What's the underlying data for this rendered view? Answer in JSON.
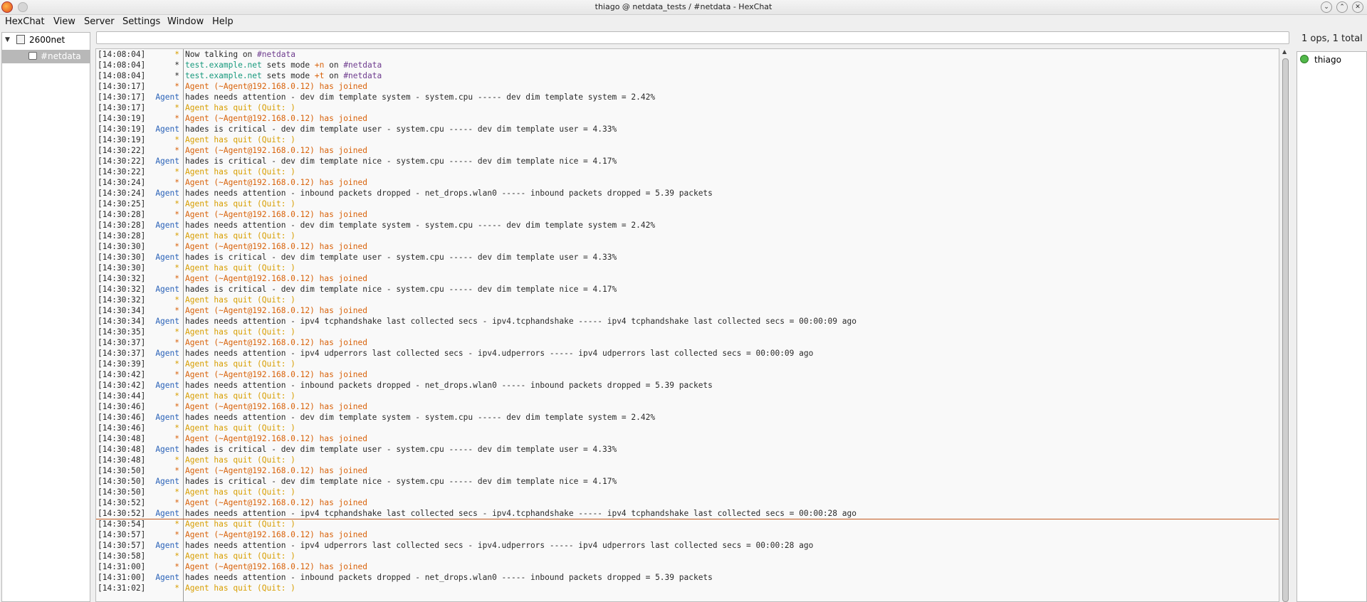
{
  "window": {
    "title": "thiago @ netdata_tests / #netdata - HexChat"
  },
  "menu": [
    {
      "label": "HexChat",
      "name": "menu-hexchat"
    },
    {
      "label": "View",
      "name": "menu-view"
    },
    {
      "label": "Server",
      "name": "menu-server"
    },
    {
      "label": "Settings",
      "name": "menu-settings"
    },
    {
      "label": "Window",
      "name": "menu-window"
    },
    {
      "label": "Help",
      "name": "menu-help"
    }
  ],
  "tree": {
    "server": "2600net",
    "channel": "#netdata"
  },
  "topic": {
    "value": ""
  },
  "ops_status": "1 ops, 1 total",
  "users": [
    {
      "name": "thiago",
      "status_color": "#52b84a"
    }
  ],
  "colors": {
    "join": "#d9620a",
    "quit": "#d89e00",
    "agent_nick": "#2a62b8",
    "server_host": "#199a7e",
    "channel_name": "#6f3d8f"
  },
  "chat_lines": [
    {
      "ts": "[14:08:04]",
      "nick": "*",
      "nick_class": "c-yellow",
      "parts": [
        {
          "t": "Now talking on ",
          "c": "c-dark"
        },
        {
          "t": "#netdata",
          "c": "c-purple"
        }
      ]
    },
    {
      "ts": "[14:08:04]",
      "nick": "*",
      "nick_class": "c-dark",
      "parts": [
        {
          "t": "test.example.net",
          "c": "c-teal"
        },
        {
          "t": " sets mode ",
          "c": "c-dark"
        },
        {
          "t": "+n",
          "c": "c-orange"
        },
        {
          "t": " on ",
          "c": "c-dark"
        },
        {
          "t": "#netdata",
          "c": "c-purple"
        }
      ]
    },
    {
      "ts": "[14:08:04]",
      "nick": "*",
      "nick_class": "c-dark",
      "parts": [
        {
          "t": "test.example.net",
          "c": "c-teal"
        },
        {
          "t": " sets mode ",
          "c": "c-dark"
        },
        {
          "t": "+t",
          "c": "c-orange"
        },
        {
          "t": " on ",
          "c": "c-dark"
        },
        {
          "t": "#netdata",
          "c": "c-purple"
        }
      ]
    },
    {
      "ts": "[14:30:17]",
      "nick": "*",
      "nick_class": "c-orange",
      "parts": [
        {
          "t": "Agent (~Agent@192.168.0.12) has joined",
          "c": "c-orange"
        }
      ]
    },
    {
      "ts": "[14:30:17]",
      "nick": "Agent",
      "nick_class": "c-blue",
      "parts": [
        {
          "t": "hades needs attention - dev dim template system - system.cpu ----- dev dim template system = 2.42%",
          "c": "c-dark"
        }
      ]
    },
    {
      "ts": "[14:30:17]",
      "nick": "*",
      "nick_class": "c-yellow",
      "parts": [
        {
          "t": "Agent has quit (Quit: )",
          "c": "c-yellow"
        }
      ]
    },
    {
      "ts": "[14:30:19]",
      "nick": "*",
      "nick_class": "c-orange",
      "parts": [
        {
          "t": "Agent (~Agent@192.168.0.12) has joined",
          "c": "c-orange"
        }
      ]
    },
    {
      "ts": "[14:30:19]",
      "nick": "Agent",
      "nick_class": "c-blue",
      "parts": [
        {
          "t": "hades is critical - dev dim template user - system.cpu ----- dev dim template user = 4.33%",
          "c": "c-dark"
        }
      ]
    },
    {
      "ts": "[14:30:19]",
      "nick": "*",
      "nick_class": "c-yellow",
      "parts": [
        {
          "t": "Agent has quit (Quit: )",
          "c": "c-yellow"
        }
      ]
    },
    {
      "ts": "[14:30:22]",
      "nick": "*",
      "nick_class": "c-orange",
      "parts": [
        {
          "t": "Agent (~Agent@192.168.0.12) has joined",
          "c": "c-orange"
        }
      ]
    },
    {
      "ts": "[14:30:22]",
      "nick": "Agent",
      "nick_class": "c-blue",
      "parts": [
        {
          "t": "hades is critical - dev dim template nice - system.cpu ----- dev dim template nice = 4.17%",
          "c": "c-dark"
        }
      ]
    },
    {
      "ts": "[14:30:22]",
      "nick": "*",
      "nick_class": "c-yellow",
      "parts": [
        {
          "t": "Agent has quit (Quit: )",
          "c": "c-yellow"
        }
      ]
    },
    {
      "ts": "[14:30:24]",
      "nick": "*",
      "nick_class": "c-orange",
      "parts": [
        {
          "t": "Agent (~Agent@192.168.0.12) has joined",
          "c": "c-orange"
        }
      ]
    },
    {
      "ts": "[14:30:24]",
      "nick": "Agent",
      "nick_class": "c-blue",
      "parts": [
        {
          "t": "hades needs attention - inbound packets dropped - net_drops.wlan0 ----- inbound packets dropped = 5.39 packets",
          "c": "c-dark"
        }
      ]
    },
    {
      "ts": "[14:30:25]",
      "nick": "*",
      "nick_class": "c-yellow",
      "parts": [
        {
          "t": "Agent has quit (Quit: )",
          "c": "c-yellow"
        }
      ]
    },
    {
      "ts": "[14:30:28]",
      "nick": "*",
      "nick_class": "c-orange",
      "parts": [
        {
          "t": "Agent (~Agent@192.168.0.12) has joined",
          "c": "c-orange"
        }
      ]
    },
    {
      "ts": "[14:30:28]",
      "nick": "Agent",
      "nick_class": "c-blue",
      "parts": [
        {
          "t": "hades needs attention - dev dim template system - system.cpu ----- dev dim template system = 2.42%",
          "c": "c-dark"
        }
      ]
    },
    {
      "ts": "[14:30:28]",
      "nick": "*",
      "nick_class": "c-yellow",
      "parts": [
        {
          "t": "Agent has quit (Quit: )",
          "c": "c-yellow"
        }
      ]
    },
    {
      "ts": "[14:30:30]",
      "nick": "*",
      "nick_class": "c-orange",
      "parts": [
        {
          "t": "Agent (~Agent@192.168.0.12) has joined",
          "c": "c-orange"
        }
      ]
    },
    {
      "ts": "[14:30:30]",
      "nick": "Agent",
      "nick_class": "c-blue",
      "parts": [
        {
          "t": "hades is critical - dev dim template user - system.cpu ----- dev dim template user = 4.33%",
          "c": "c-dark"
        }
      ]
    },
    {
      "ts": "[14:30:30]",
      "nick": "*",
      "nick_class": "c-yellow",
      "parts": [
        {
          "t": "Agent has quit (Quit: )",
          "c": "c-yellow"
        }
      ]
    },
    {
      "ts": "[14:30:32]",
      "nick": "*",
      "nick_class": "c-orange",
      "parts": [
        {
          "t": "Agent (~Agent@192.168.0.12) has joined",
          "c": "c-orange"
        }
      ]
    },
    {
      "ts": "[14:30:32]",
      "nick": "Agent",
      "nick_class": "c-blue",
      "parts": [
        {
          "t": "hades is critical - dev dim template nice - system.cpu ----- dev dim template nice = 4.17%",
          "c": "c-dark"
        }
      ]
    },
    {
      "ts": "[14:30:32]",
      "nick": "*",
      "nick_class": "c-yellow",
      "parts": [
        {
          "t": "Agent has quit (Quit: )",
          "c": "c-yellow"
        }
      ]
    },
    {
      "ts": "[14:30:34]",
      "nick": "*",
      "nick_class": "c-orange",
      "parts": [
        {
          "t": "Agent (~Agent@192.168.0.12) has joined",
          "c": "c-orange"
        }
      ]
    },
    {
      "ts": "[14:30:34]",
      "nick": "Agent",
      "nick_class": "c-blue",
      "parts": [
        {
          "t": "hades needs attention - ipv4 tcphandshake last collected secs - ipv4.tcphandshake ----- ipv4 tcphandshake last collected secs = 00:00:09 ago",
          "c": "c-dark"
        }
      ]
    },
    {
      "ts": "[14:30:35]",
      "nick": "*",
      "nick_class": "c-yellow",
      "parts": [
        {
          "t": "Agent has quit (Quit: )",
          "c": "c-yellow"
        }
      ]
    },
    {
      "ts": "[14:30:37]",
      "nick": "*",
      "nick_class": "c-orange",
      "parts": [
        {
          "t": "Agent (~Agent@192.168.0.12) has joined",
          "c": "c-orange"
        }
      ]
    },
    {
      "ts": "[14:30:37]",
      "nick": "Agent",
      "nick_class": "c-blue",
      "parts": [
        {
          "t": "hades needs attention - ipv4 udperrors last collected secs - ipv4.udperrors ----- ipv4 udperrors last collected secs = 00:00:09 ago",
          "c": "c-dark"
        }
      ]
    },
    {
      "ts": "[14:30:39]",
      "nick": "*",
      "nick_class": "c-yellow",
      "parts": [
        {
          "t": "Agent has quit (Quit: )",
          "c": "c-yellow"
        }
      ]
    },
    {
      "ts": "[14:30:42]",
      "nick": "*",
      "nick_class": "c-orange",
      "parts": [
        {
          "t": "Agent (~Agent@192.168.0.12) has joined",
          "c": "c-orange"
        }
      ]
    },
    {
      "ts": "[14:30:42]",
      "nick": "Agent",
      "nick_class": "c-blue",
      "parts": [
        {
          "t": "hades needs attention - inbound packets dropped - net_drops.wlan0 ----- inbound packets dropped = 5.39 packets",
          "c": "c-dark"
        }
      ]
    },
    {
      "ts": "[14:30:44]",
      "nick": "*",
      "nick_class": "c-yellow",
      "parts": [
        {
          "t": "Agent has quit (Quit: )",
          "c": "c-yellow"
        }
      ]
    },
    {
      "ts": "[14:30:46]",
      "nick": "*",
      "nick_class": "c-orange",
      "parts": [
        {
          "t": "Agent (~Agent@192.168.0.12) has joined",
          "c": "c-orange"
        }
      ]
    },
    {
      "ts": "[14:30:46]",
      "nick": "Agent",
      "nick_class": "c-blue",
      "parts": [
        {
          "t": "hades needs attention - dev dim template system - system.cpu ----- dev dim template system = 2.42%",
          "c": "c-dark"
        }
      ]
    },
    {
      "ts": "[14:30:46]",
      "nick": "*",
      "nick_class": "c-yellow",
      "parts": [
        {
          "t": "Agent has quit (Quit: )",
          "c": "c-yellow"
        }
      ]
    },
    {
      "ts": "[14:30:48]",
      "nick": "*",
      "nick_class": "c-orange",
      "parts": [
        {
          "t": "Agent (~Agent@192.168.0.12) has joined",
          "c": "c-orange"
        }
      ]
    },
    {
      "ts": "[14:30:48]",
      "nick": "Agent",
      "nick_class": "c-blue",
      "parts": [
        {
          "t": "hades is critical - dev dim template user - system.cpu ----- dev dim template user = 4.33%",
          "c": "c-dark"
        }
      ]
    },
    {
      "ts": "[14:30:48]",
      "nick": "*",
      "nick_class": "c-yellow",
      "parts": [
        {
          "t": "Agent has quit (Quit: )",
          "c": "c-yellow"
        }
      ]
    },
    {
      "ts": "[14:30:50]",
      "nick": "*",
      "nick_class": "c-orange",
      "parts": [
        {
          "t": "Agent (~Agent@192.168.0.12) has joined",
          "c": "c-orange"
        }
      ]
    },
    {
      "ts": "[14:30:50]",
      "nick": "Agent",
      "nick_class": "c-blue",
      "parts": [
        {
          "t": "hades is critical - dev dim template nice - system.cpu ----- dev dim template nice = 4.17%",
          "c": "c-dark"
        }
      ]
    },
    {
      "ts": "[14:30:50]",
      "nick": "*",
      "nick_class": "c-yellow",
      "parts": [
        {
          "t": "Agent has quit (Quit: )",
          "c": "c-yellow"
        }
      ]
    },
    {
      "ts": "[14:30:52]",
      "nick": "*",
      "nick_class": "c-orange",
      "parts": [
        {
          "t": "Agent (~Agent@192.168.0.12) has joined",
          "c": "c-orange"
        }
      ]
    },
    {
      "ts": "[14:30:52]",
      "nick": "Agent",
      "nick_class": "c-blue",
      "parts": [
        {
          "t": "hades needs attention - ipv4 tcphandshake last collected secs - ipv4.tcphandshake ----- ipv4 tcphandshake last collected secs = 00:00:28 ago",
          "c": "c-dark"
        }
      ]
    },
    {
      "ts": "[14:30:54]",
      "nick": "*",
      "nick_class": "c-yellow",
      "parts": [
        {
          "t": "Agent has quit (Quit: )",
          "c": "c-yellow"
        }
      ]
    },
    {
      "ts": "[14:30:57]",
      "nick": "*",
      "nick_class": "c-orange",
      "parts": [
        {
          "t": "Agent (~Agent@192.168.0.12) has joined",
          "c": "c-orange"
        }
      ]
    },
    {
      "ts": "[14:30:57]",
      "nick": "Agent",
      "nick_class": "c-blue",
      "parts": [
        {
          "t": "hades needs attention - ipv4 udperrors last collected secs - ipv4.udperrors ----- ipv4 udperrors last collected secs = 00:00:28 ago",
          "c": "c-dark"
        }
      ]
    },
    {
      "ts": "[14:30:58]",
      "nick": "*",
      "nick_class": "c-yellow",
      "parts": [
        {
          "t": "Agent has quit (Quit: )",
          "c": "c-yellow"
        }
      ]
    },
    {
      "ts": "[14:31:00]",
      "nick": "*",
      "nick_class": "c-orange",
      "parts": [
        {
          "t": "Agent (~Agent@192.168.0.12) has joined",
          "c": "c-orange"
        }
      ]
    },
    {
      "ts": "[14:31:00]",
      "nick": "Agent",
      "nick_class": "c-blue",
      "parts": [
        {
          "t": "hades needs attention - inbound packets dropped - net_drops.wlan0 ----- inbound packets dropped = 5.39 packets",
          "c": "c-dark"
        }
      ]
    },
    {
      "ts": "[14:31:02]",
      "nick": "*",
      "nick_class": "c-yellow",
      "parts": [
        {
          "t": "Agent has quit (Quit: )",
          "c": "c-yellow"
        }
      ]
    }
  ]
}
